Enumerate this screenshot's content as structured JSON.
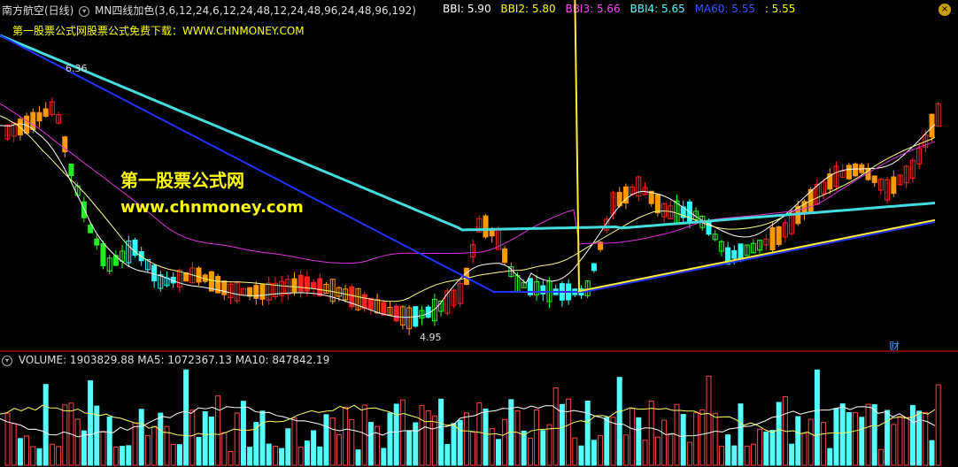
{
  "header": {
    "stock_name": "南方航空(日线)",
    "indicator": "MN四线加色(3,6,12,24,6,12,24,48,12,24,48,96,24,48,96,192)"
  },
  "bbi": [
    {
      "label": "BBI: 5.90",
      "color": "#ffffff"
    },
    {
      "label": "BBI2: 5.80",
      "color": "#ffff00"
    },
    {
      "label": "BBI3: 5.66",
      "color": "#ff44ff"
    },
    {
      "label": "BBI4: 5.65",
      "color": "#55ffff"
    },
    {
      "label": "MA60: 5.55",
      "color": "#3355ff"
    },
    {
      "label": ": 5.55",
      "color": "#ffff00"
    }
  ],
  "promo_text": "第一股票公式网股票公式免费下载：WWW.CHNMONEY.COM",
  "watermark": {
    "line1": "第一股票公式网",
    "line2": "www.chnmoney.com"
  },
  "price_labels": {
    "high": "6.36",
    "low": "4.95"
  },
  "cai_label": "财",
  "volume_header": {
    "volume": "VOLUME: 1903829.88",
    "ma5": "MA5: 1072367.13",
    "ma10": "MA10: 847842.19"
  },
  "close_icon": "close-icon",
  "colors": {
    "up": "#ff2020",
    "down": "#33ffff",
    "orange": "#ff9900",
    "green": "#22ff22",
    "ma60": "#2233ff",
    "bbi4": "#44dddd"
  }
}
